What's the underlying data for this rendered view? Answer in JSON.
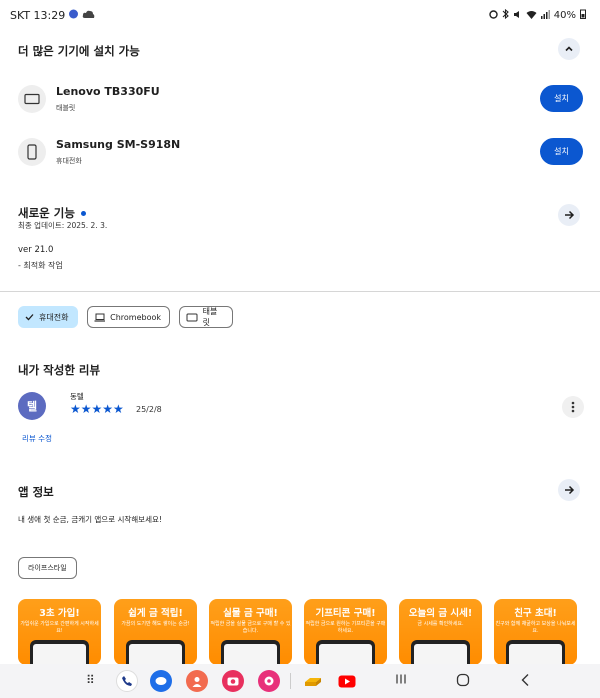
{
  "status_bar": {
    "carrier_time": "SKT 13:29",
    "battery": "40%"
  },
  "devices_section": {
    "title": "더 많은 기기에 설치 가능",
    "devices": [
      {
        "name": "Lenovo TB330FU",
        "type": "태블릿",
        "install_label": "설치",
        "icon": "tablet-icon"
      },
      {
        "name": "Samsung SM-S918N",
        "type": "휴대전화",
        "install_label": "설치",
        "icon": "phone-icon"
      }
    ]
  },
  "whats_new": {
    "title": "새로운 기능",
    "updated": "최종 업데이트: 2025. 2. 3.",
    "version": "ver 21.0",
    "note": "- 최적화 작업"
  },
  "device_chips": [
    {
      "label": "휴대전화",
      "selected": true,
      "icon": "check-icon"
    },
    {
      "label": "Chromebook",
      "selected": false,
      "icon": "laptop-icon"
    },
    {
      "label": "태블릿",
      "selected": false,
      "icon": "tablet-icon"
    }
  ],
  "my_review": {
    "title": "내가 작성한 리뷰",
    "avatar_letter": "텔",
    "user": "동텔",
    "rating": 5,
    "stars": "★★★★★",
    "date": "25/2/8",
    "edit_label": "리뷰 수정"
  },
  "app_info": {
    "title": "앱 정보",
    "description": "내 생애 첫 순금, 금캐기 앱으로 시작해보세요!",
    "tag": "라이프스타일"
  },
  "screenshots": [
    {
      "title": "3초 가입!",
      "sub": "가입쉬운 가입으로 간편하게 시작하세요!"
    },
    {
      "title": "쉽게 금 적립!",
      "sub": "가끔의 도기만 해도 쌓이는 순금!"
    },
    {
      "title": "실물 금 구매!",
      "sub": "적립한 금을 실물 금으로 구매 할 수 있습니다."
    },
    {
      "title": "기프티콘 구매!",
      "sub": "적립한 금으로 원하는 기프티콘을 구매하세요."
    },
    {
      "title": "오늘의 금 시세!",
      "sub": "금 시세를 확인하세요."
    },
    {
      "title": "친구 초대!",
      "sub": "친구와 함께 채굴하고 보상을 나눠보세요."
    }
  ],
  "colors": {
    "accent": "#0b57d0",
    "chip_selected": "#c2e7ff",
    "screenshot_orange": "#ff9800"
  }
}
